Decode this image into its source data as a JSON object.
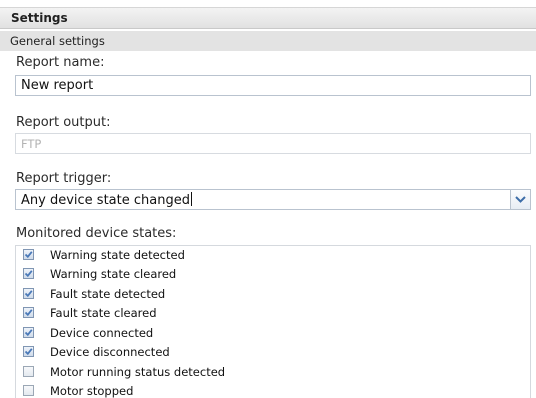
{
  "header": {
    "title": "Settings"
  },
  "section": {
    "title": "General settings"
  },
  "report_name": {
    "label": "Report name:",
    "value": "New report"
  },
  "report_output": {
    "label": "Report output:",
    "value": "FTP"
  },
  "report_trigger": {
    "label": "Report trigger:",
    "value": "Any device state changed"
  },
  "monitored": {
    "label": "Monitored device states:",
    "items": [
      {
        "label": "Warning state detected",
        "checked": true
      },
      {
        "label": "Warning state cleared",
        "checked": true
      },
      {
        "label": "Fault state detected",
        "checked": true
      },
      {
        "label": "Fault state cleared",
        "checked": true
      },
      {
        "label": "Device connected",
        "checked": true
      },
      {
        "label": "Device disconnected",
        "checked": true
      },
      {
        "label": "Motor running status detected",
        "checked": false
      },
      {
        "label": "Motor stopped",
        "checked": false
      }
    ]
  },
  "colors": {
    "accent": "#4a79b8",
    "border": "#b9c3cf"
  }
}
